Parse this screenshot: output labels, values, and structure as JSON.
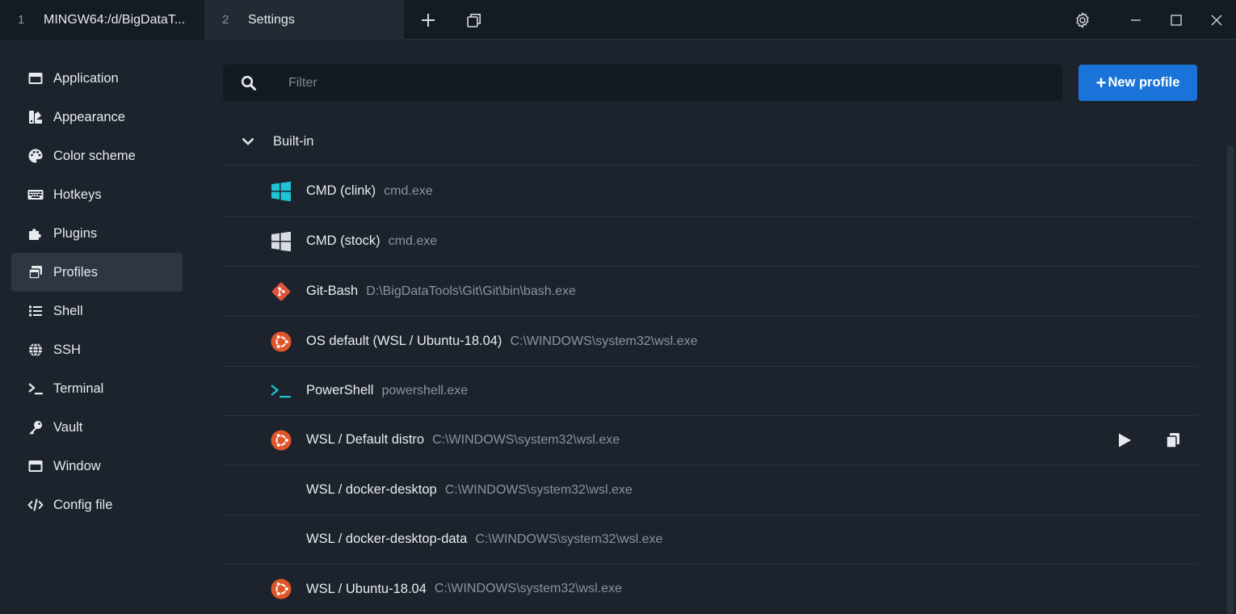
{
  "titlebar": {
    "tabs": [
      {
        "number": "1",
        "label": "MINGW64:/d/BigDataT..."
      },
      {
        "number": "2",
        "label": "Settings"
      }
    ],
    "icons": [
      "plus-icon",
      "tabs-icon",
      "gear-icon",
      "minimize-icon",
      "maximize-icon",
      "close-icon"
    ]
  },
  "sidebar": {
    "items": [
      {
        "label": "Application",
        "icon": "window-icon"
      },
      {
        "label": "Appearance",
        "icon": "swatches-icon"
      },
      {
        "label": "Color scheme",
        "icon": "palette-icon"
      },
      {
        "label": "Hotkeys",
        "icon": "keyboard-icon"
      },
      {
        "label": "Plugins",
        "icon": "puzzle-icon"
      },
      {
        "label": "Profiles",
        "icon": "windows-stack-icon",
        "active": true
      },
      {
        "label": "Shell",
        "icon": "list-icon"
      },
      {
        "label": "SSH",
        "icon": "globe-icon"
      },
      {
        "label": "Terminal",
        "icon": "terminal-icon"
      },
      {
        "label": "Vault",
        "icon": "key-icon"
      },
      {
        "label": "Window",
        "icon": "window-icon"
      },
      {
        "label": "Config file",
        "icon": "code-icon"
      }
    ]
  },
  "filter": {
    "placeholder": "Filter"
  },
  "new_profile": {
    "label": "New profile"
  },
  "group": {
    "label": "Built-in"
  },
  "profiles": [
    {
      "name": "CMD (clink)",
      "path": "cmd.exe",
      "icon": "windows-logo-icon"
    },
    {
      "name": "CMD (stock)",
      "path": "cmd.exe",
      "icon": "windows-logo-icon"
    },
    {
      "name": "Git-Bash",
      "path": "D:\\BigDataTools\\Git\\Git\\bin\\bash.exe",
      "icon": "git-icon"
    },
    {
      "name": "OS default (WSL / Ubuntu-18.04)",
      "path": "C:\\WINDOWS\\system32\\wsl.exe",
      "icon": "ubuntu-icon"
    },
    {
      "name": "PowerShell",
      "path": "powershell.exe",
      "icon": "powershell-icon"
    },
    {
      "name": "WSL / Default distro",
      "path": "C:\\WINDOWS\\system32\\wsl.exe",
      "icon": "ubuntu-icon"
    },
    {
      "name": "WSL / docker-desktop",
      "path": "C:\\WINDOWS\\system32\\wsl.exe",
      "icon": ""
    },
    {
      "name": "WSL / docker-desktop-data",
      "path": "C:\\WINDOWS\\system32\\wsl.exe",
      "icon": ""
    },
    {
      "name": "WSL / Ubuntu-18.04",
      "path": "C:\\WINDOWS\\system32\\wsl.exe",
      "icon": "ubuntu-icon"
    }
  ],
  "colors": {
    "accent": "#1a73d9",
    "background": "#1c232c",
    "windows_logo_cyan": "#1fc3d6",
    "windows_logo_grey": "#d9dde2",
    "git": "#e0543b",
    "ubuntu": "#e0562a"
  }
}
